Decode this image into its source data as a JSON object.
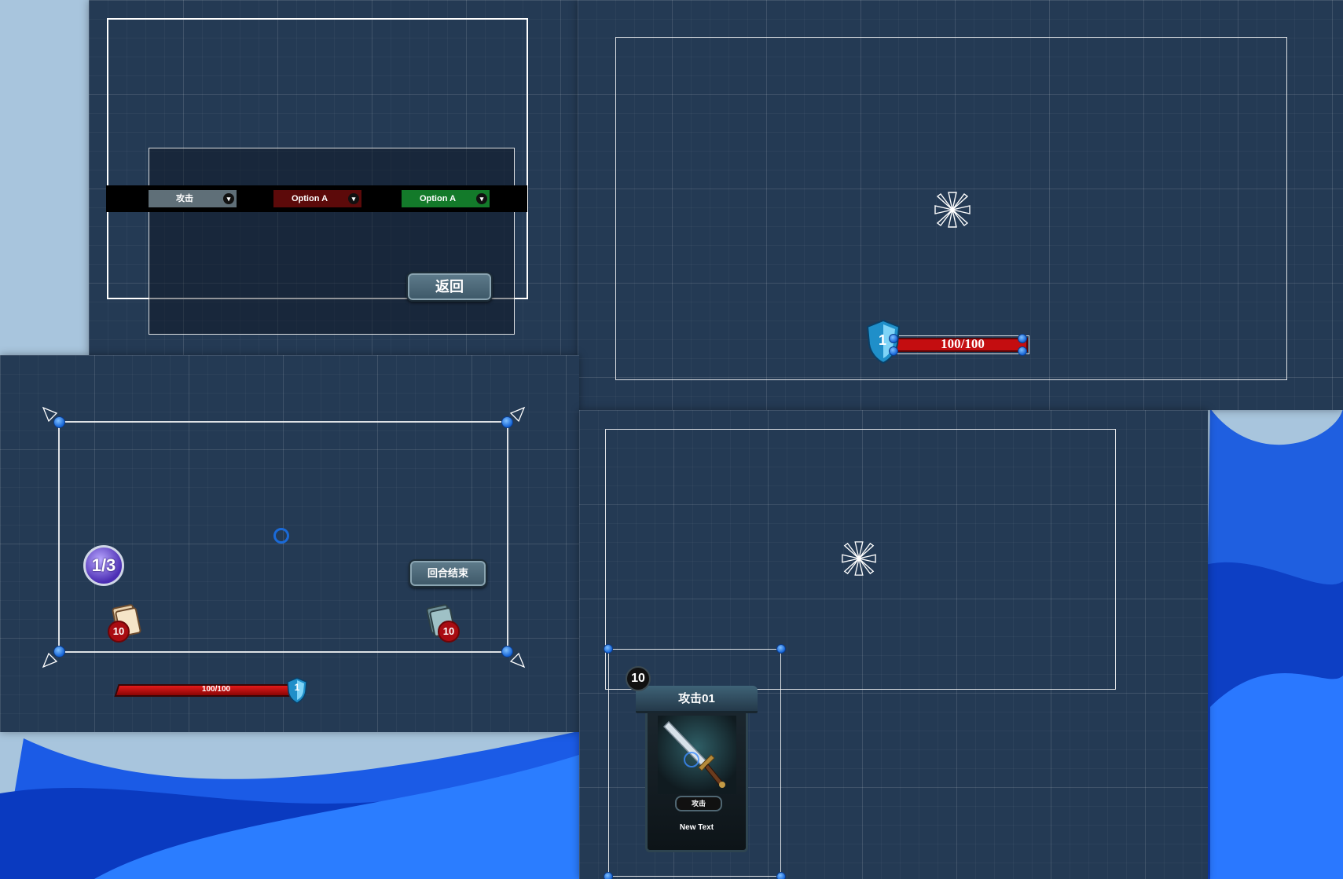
{
  "colors": {
    "panel_bg": "#243a54",
    "dropdown_gray": "#5f6f78",
    "dropdown_red": "#5c0a0a",
    "dropdown_green": "#137a2a",
    "hp_red": "#c40d10",
    "handle_blue": "#1463d6"
  },
  "top_left": {
    "dropdowns": [
      {
        "label": "攻击",
        "color": "#5f6f78"
      },
      {
        "label": "Option A",
        "color": "#5c0a0a"
      },
      {
        "label": "Option A",
        "color": "#137a2a"
      }
    ],
    "back_button": "返回"
  },
  "top_right": {
    "shield_level": "1",
    "hp_text": "100/100"
  },
  "bottom_left": {
    "turn_badge": "1/3",
    "deck_count": "10",
    "discard_count": "10",
    "end_turn_button": "回合结束",
    "hp_text": "100/100",
    "shield_level": "1"
  },
  "bottom_right": {
    "card": {
      "cost": "10",
      "title": "攻击01",
      "type_label": "攻击",
      "description": "New Text",
      "art_icon": "sword-icon"
    }
  }
}
